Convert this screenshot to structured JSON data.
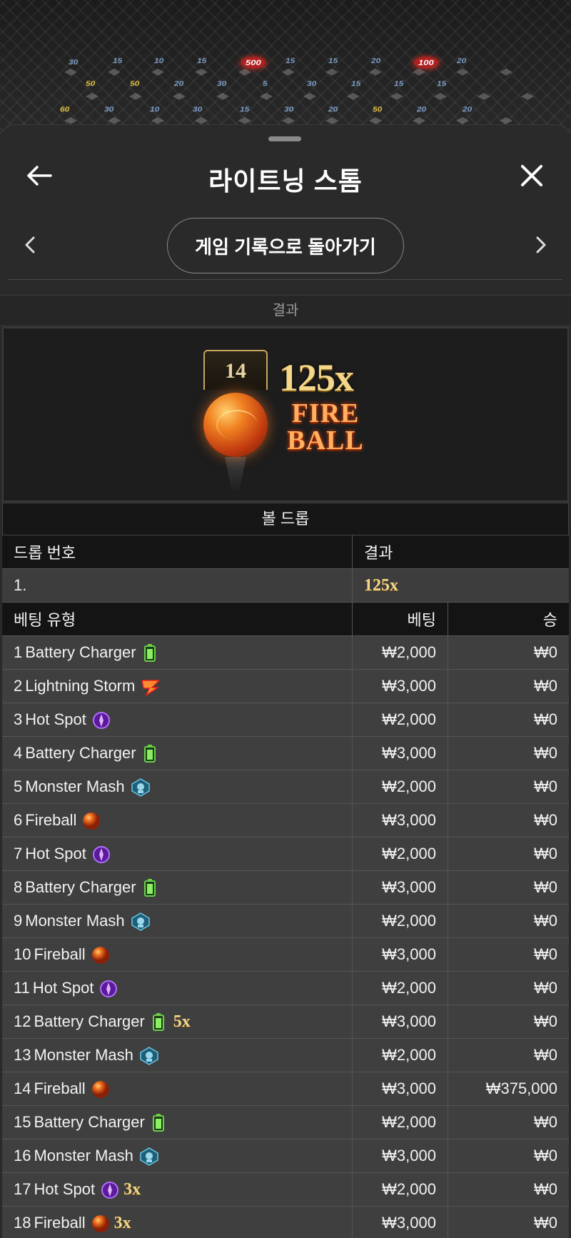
{
  "header": {
    "title": "라이트닝 스톰",
    "history_button": "게임 기록으로 돌아가기"
  },
  "result_section": {
    "heading": "결과",
    "tile_number": "14",
    "multiplier": "125x",
    "type_line1": "FIRE",
    "type_line2": "BALL"
  },
  "ball_drop": {
    "caption": "볼 드롭",
    "col_drop_no": "드롭 번호",
    "col_result": "결과",
    "rows": [
      {
        "no": "1.",
        "result": "125x"
      }
    ]
  },
  "bets": {
    "col_type": "베팅 유형",
    "col_bet": "베팅",
    "col_win": "승",
    "rows": [
      {
        "no": "1",
        "name": "Battery Charger",
        "icon": "battery-icon",
        "mult": "",
        "bet": "₩2,000",
        "win": "₩0"
      },
      {
        "no": "2",
        "name": "Lightning Storm",
        "icon": "lightning-icon",
        "mult": "",
        "bet": "₩3,000",
        "win": "₩0"
      },
      {
        "no": "3",
        "name": "Hot Spot",
        "icon": "hotspot-icon",
        "mult": "",
        "bet": "₩2,000",
        "win": "₩0"
      },
      {
        "no": "4",
        "name": "Battery Charger",
        "icon": "battery-icon",
        "mult": "",
        "bet": "₩3,000",
        "win": "₩0"
      },
      {
        "no": "5",
        "name": "Monster Mash",
        "icon": "monster-icon",
        "mult": "",
        "bet": "₩2,000",
        "win": "₩0"
      },
      {
        "no": "6",
        "name": "Fireball",
        "icon": "fireball-icon",
        "mult": "",
        "bet": "₩3,000",
        "win": "₩0"
      },
      {
        "no": "7",
        "name": "Hot Spot",
        "icon": "hotspot-icon",
        "mult": "",
        "bet": "₩2,000",
        "win": "₩0"
      },
      {
        "no": "8",
        "name": "Battery Charger",
        "icon": "battery-icon",
        "mult": "",
        "bet": "₩3,000",
        "win": "₩0"
      },
      {
        "no": "9",
        "name": "Monster Mash",
        "icon": "monster-icon",
        "mult": "",
        "bet": "₩2,000",
        "win": "₩0"
      },
      {
        "no": "10",
        "name": "Fireball",
        "icon": "fireball-icon",
        "mult": "",
        "bet": "₩3,000",
        "win": "₩0"
      },
      {
        "no": "11",
        "name": "Hot Spot",
        "icon": "hotspot-icon",
        "mult": "",
        "bet": "₩2,000",
        "win": "₩0"
      },
      {
        "no": "12",
        "name": "Battery Charger",
        "icon": "battery-icon",
        "mult": "5x",
        "bet": "₩3,000",
        "win": "₩0"
      },
      {
        "no": "13",
        "name": "Monster Mash",
        "icon": "monster-icon",
        "mult": "",
        "bet": "₩2,000",
        "win": "₩0"
      },
      {
        "no": "14",
        "name": "Fireball",
        "icon": "fireball-icon",
        "mult": "",
        "bet": "₩3,000",
        "win": "₩375,000"
      },
      {
        "no": "15",
        "name": "Battery Charger",
        "icon": "battery-icon",
        "mult": "",
        "bet": "₩2,000",
        "win": "₩0"
      },
      {
        "no": "16",
        "name": "Monster Mash",
        "icon": "monster-icon",
        "mult": "",
        "bet": "₩3,000",
        "win": "₩0"
      },
      {
        "no": "17",
        "name": "Hot Spot",
        "icon": "hotspot-icon",
        "mult": "3x",
        "bet": "₩2,000",
        "win": "₩0"
      },
      {
        "no": "18",
        "name": "Fireball",
        "icon": "fireball-icon",
        "mult": "3x",
        "bet": "₩3,000",
        "win": "₩0"
      }
    ]
  },
  "background_board": {
    "values": [
      "30",
      "15",
      "10",
      "15",
      "500",
      "15",
      "15",
      "20",
      "100",
      "20",
      "50",
      "50",
      "20",
      "30",
      "5",
      "30",
      "15",
      "15",
      "15",
      "60",
      "30",
      "10",
      "30",
      "15",
      "30",
      "20",
      "50",
      "20",
      "20"
    ]
  },
  "colors": {
    "panel": "#2a2a2a",
    "gold": "#f4d78a",
    "fire": "#ffb060"
  }
}
